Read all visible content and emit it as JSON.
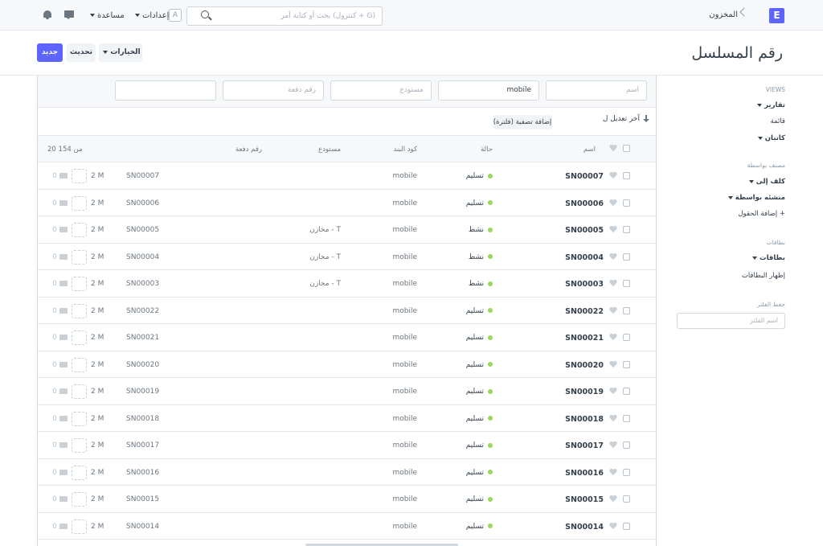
{
  "navbar": {
    "brand_letter": "E",
    "breadcrumb": "المخزون",
    "search_placeholder": "بحث أو كتابة أمر (كنترول + G)",
    "avatar_letter": "A",
    "settings_label": "إعدادات",
    "help_label": "مساعدة"
  },
  "page": {
    "title": "رقم المسلسل",
    "new_label": "جديد",
    "refresh_label": "تحديث",
    "menu_label": "الخيارات"
  },
  "filters": {
    "name_placeholder": "اسم",
    "item_code_value": "mobile",
    "warehouse_placeholder": "مستودع",
    "batch_placeholder": "رقم دفعة",
    "empty_value": ""
  },
  "toolbar": {
    "sort_label": "آخر تعديل ل",
    "add_filter_label": "إضافة تصفية (فلترة)"
  },
  "list": {
    "headers": {
      "name": "اسم",
      "status": "حالة",
      "item_code": "كود البند",
      "warehouse": "مستودع",
      "batch": "رقم دفعة",
      "count": "20 من 154"
    },
    "rows": [
      {
        "name": "SN00007",
        "status": "تسليم",
        "item_code": "mobile",
        "warehouse": "",
        "serial": "SN00007",
        "modified": "2 M",
        "comments": "0"
      },
      {
        "name": "SN00006",
        "status": "تسليم",
        "item_code": "mobile",
        "warehouse": "",
        "serial": "SN00006",
        "modified": "2 M",
        "comments": "0"
      },
      {
        "name": "SN00005",
        "status": "نشط",
        "item_code": "mobile",
        "warehouse": "مخازن - T",
        "serial": "SN00005",
        "modified": "2 M",
        "comments": "0"
      },
      {
        "name": "SN00004",
        "status": "نشط",
        "item_code": "mobile",
        "warehouse": "مخازن - T",
        "serial": "SN00004",
        "modified": "2 M",
        "comments": "0"
      },
      {
        "name": "SN00003",
        "status": "نشط",
        "item_code": "mobile",
        "warehouse": "مخازن - T",
        "serial": "SN00003",
        "modified": "2 M",
        "comments": "0"
      },
      {
        "name": "SN00022",
        "status": "تسليم",
        "item_code": "mobile",
        "warehouse": "",
        "serial": "SN00022",
        "modified": "2 M",
        "comments": "0"
      },
      {
        "name": "SN00021",
        "status": "تسليم",
        "item_code": "mobile",
        "warehouse": "",
        "serial": "SN00021",
        "modified": "2 M",
        "comments": "0"
      },
      {
        "name": "SN00020",
        "status": "تسليم",
        "item_code": "mobile",
        "warehouse": "",
        "serial": "SN00020",
        "modified": "2 M",
        "comments": "0"
      },
      {
        "name": "SN00019",
        "status": "تسليم",
        "item_code": "mobile",
        "warehouse": "",
        "serial": "SN00019",
        "modified": "2 M",
        "comments": "0"
      },
      {
        "name": "SN00018",
        "status": "تسليم",
        "item_code": "mobile",
        "warehouse": "",
        "serial": "SN00018",
        "modified": "2 M",
        "comments": "0"
      },
      {
        "name": "SN00017",
        "status": "تسليم",
        "item_code": "mobile",
        "warehouse": "",
        "serial": "SN00017",
        "modified": "2 M",
        "comments": "0"
      },
      {
        "name": "SN00016",
        "status": "تسليم",
        "item_code": "mobile",
        "warehouse": "",
        "serial": "SN00016",
        "modified": "2 M",
        "comments": "0"
      },
      {
        "name": "SN00015",
        "status": "تسليم",
        "item_code": "mobile",
        "warehouse": "",
        "serial": "SN00015",
        "modified": "2 M",
        "comments": "0"
      },
      {
        "name": "SN00014",
        "status": "تسليم",
        "item_code": "mobile",
        "warehouse": "",
        "serial": "SN00014",
        "modified": "2 M",
        "comments": "0"
      }
    ]
  },
  "sidebar": {
    "views_heading": "VIEWS",
    "reports": "تقارير",
    "list": "قائمة",
    "kanban": "كانبان",
    "assigned_heading": "مصنف بواسطة",
    "assigned_to": "كلف إلى",
    "created_by": "منشئه بواسطة",
    "add_field": "إضافة الحقول +",
    "tags_heading": "بطاقات",
    "tags": "بطاقات",
    "show_tags": "إظهار البطاقات",
    "filter_heading": "حفظ الفلتر",
    "filter_placeholder": "اسم الفلتر"
  },
  "colors": {
    "primary": "#5e64ff",
    "status_dot": "#98d85b"
  },
  "icons": [
    "search-icon",
    "bell-icon",
    "chat-icon",
    "heart-icon",
    "sort-icon",
    "comment-icon"
  ]
}
